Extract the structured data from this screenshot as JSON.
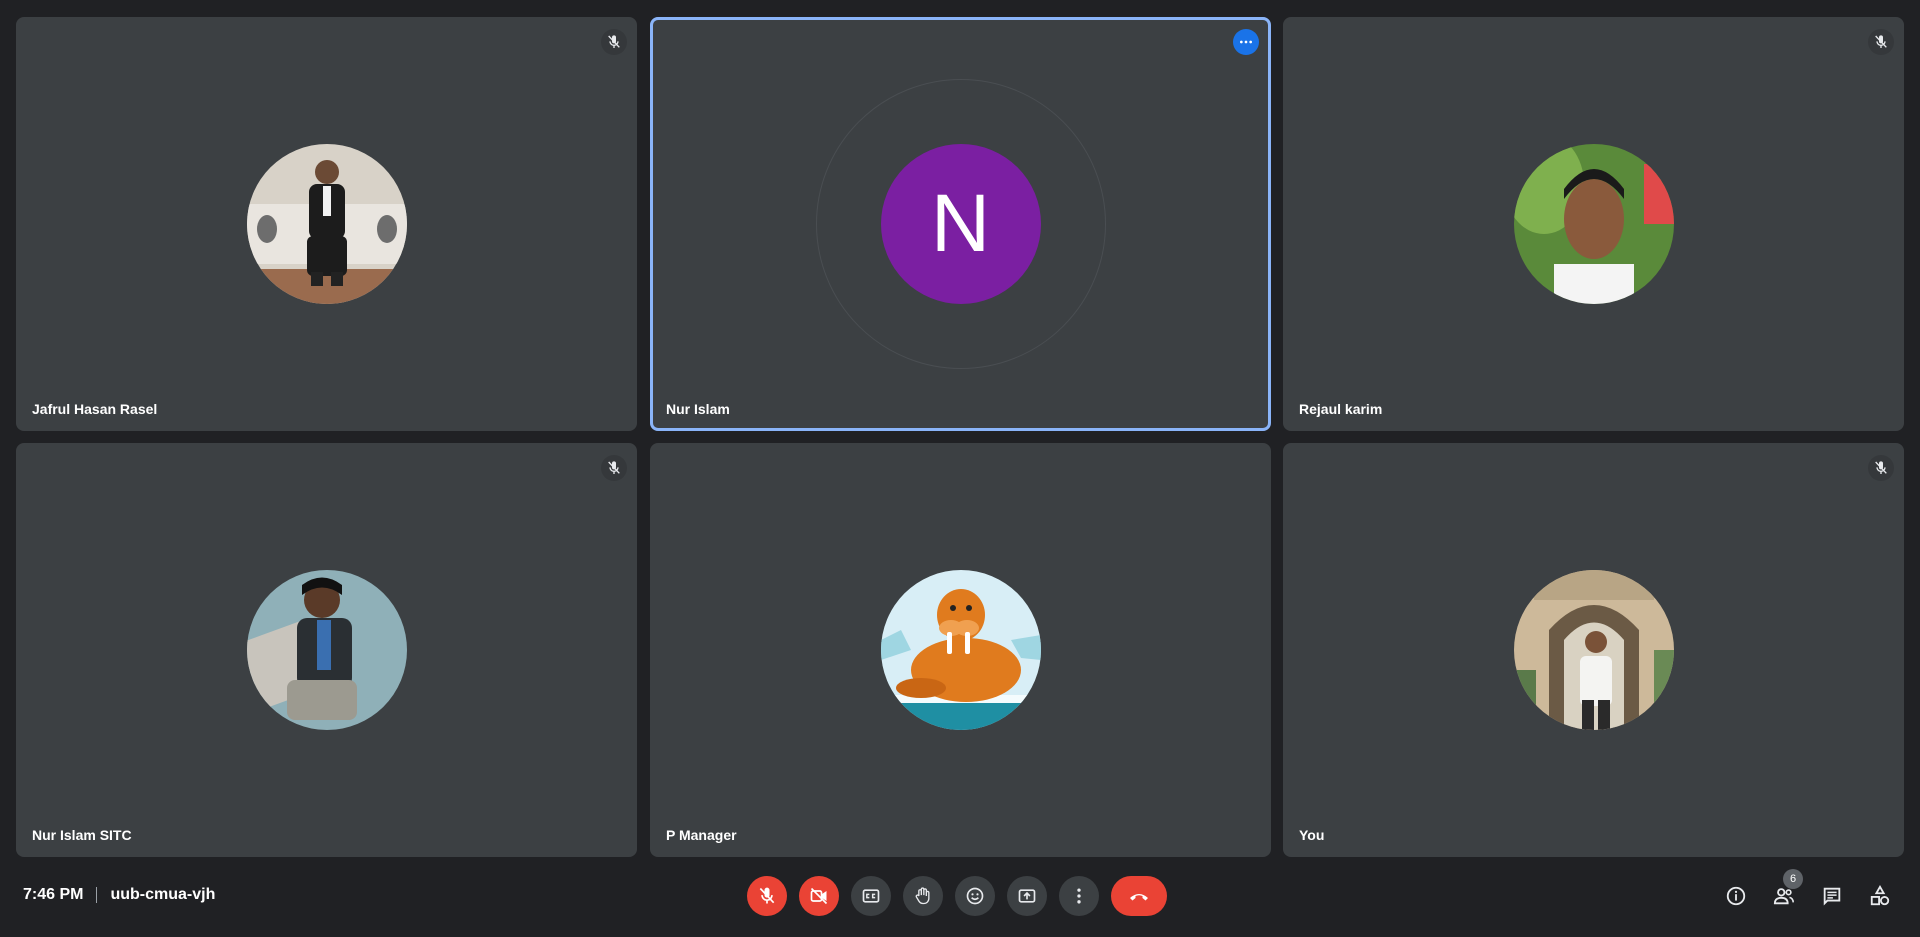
{
  "participants": [
    {
      "name": "Jafrul Hasan Rasel",
      "muted": true
    },
    {
      "name": "Nur Islam",
      "initial": "N",
      "speaking": true
    },
    {
      "name": "Rejaul karim",
      "muted": true
    },
    {
      "name": "Nur Islam SITC",
      "muted": true
    },
    {
      "name": "P Manager"
    },
    {
      "name": "You",
      "muted": true
    }
  ],
  "meeting": {
    "time": "7:46 PM",
    "code": "uub-cmua-vjh"
  },
  "people_count": "6",
  "colors": {
    "background": "#202124",
    "tile": "#3c4043",
    "danger": "#ea4335",
    "highlight": "#8ab4f8",
    "initial_avatar": "#7b1fa2"
  }
}
